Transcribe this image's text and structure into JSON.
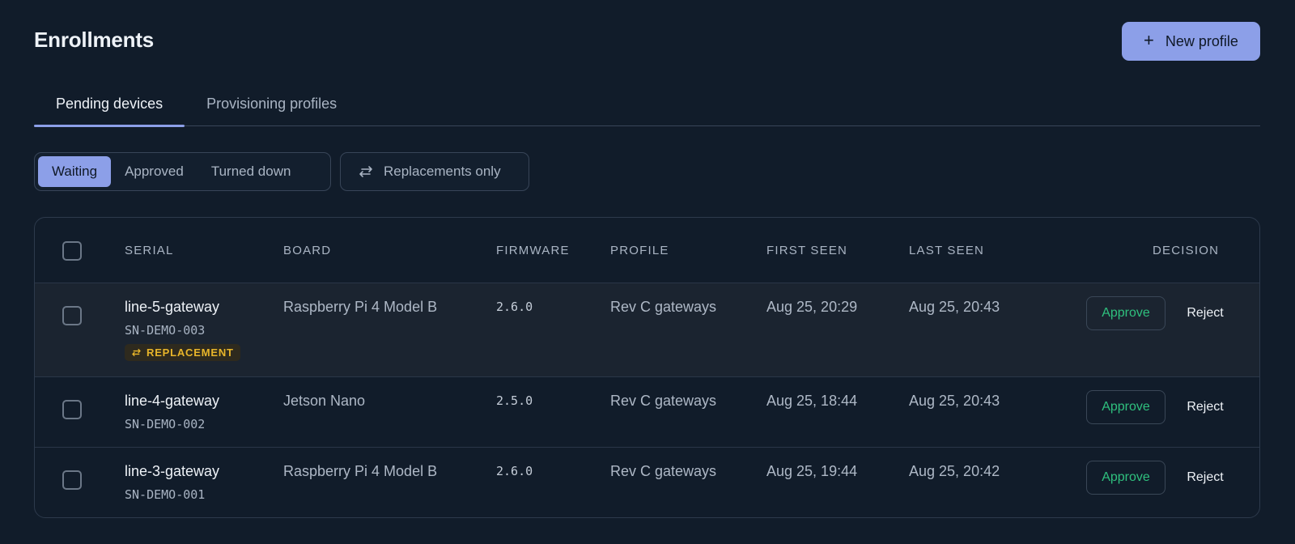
{
  "header": {
    "title": "Enrollments",
    "new_profile_label": "New profile",
    "new_profile_icon": "plus-icon"
  },
  "tabs": [
    {
      "label": "Pending devices",
      "active": true
    },
    {
      "label": "Provisioning profiles",
      "active": false
    }
  ],
  "filters": {
    "status_options": [
      {
        "label": "Waiting",
        "active": true
      },
      {
        "label": "Approved",
        "active": false
      },
      {
        "label": "Turned down",
        "active": false
      }
    ],
    "replacements_label": "Replacements only",
    "replacements_icon": "swap-arrows-icon"
  },
  "table": {
    "columns": [
      "SERIAL",
      "BOARD",
      "FIRMWARE",
      "PROFILE",
      "FIRST SEEN",
      "LAST SEEN",
      "DECISION"
    ],
    "rows": [
      {
        "name": "line-5-gateway",
        "serial": "SN-DEMO-003",
        "badge": "REPLACEMENT",
        "board": "Raspberry Pi 4 Model B",
        "firmware": "2.6.0",
        "profile": "Rev C gateways",
        "first_seen": "Aug 25, 20:29",
        "last_seen": "Aug 25, 20:43",
        "approve_label": "Approve",
        "reject_label": "Reject"
      },
      {
        "name": "line-4-gateway",
        "serial": "SN-DEMO-002",
        "board": "Jetson Nano",
        "firmware": "2.5.0",
        "profile": "Rev C gateways",
        "first_seen": "Aug 25, 18:44",
        "last_seen": "Aug 25, 20:43",
        "approve_label": "Approve",
        "reject_label": "Reject"
      },
      {
        "name": "line-3-gateway",
        "serial": "SN-DEMO-001",
        "board": "Raspberry Pi 4 Model B",
        "firmware": "2.6.0",
        "profile": "Rev C gateways",
        "first_seen": "Aug 25, 19:44",
        "last_seen": "Aug 25, 20:42",
        "approve_label": "Approve",
        "reject_label": "Reject"
      }
    ]
  },
  "colors": {
    "background": "#111c2a",
    "accent": "#8c9fe8",
    "approve": "#2fc07e",
    "badge": "#e8b52a"
  }
}
